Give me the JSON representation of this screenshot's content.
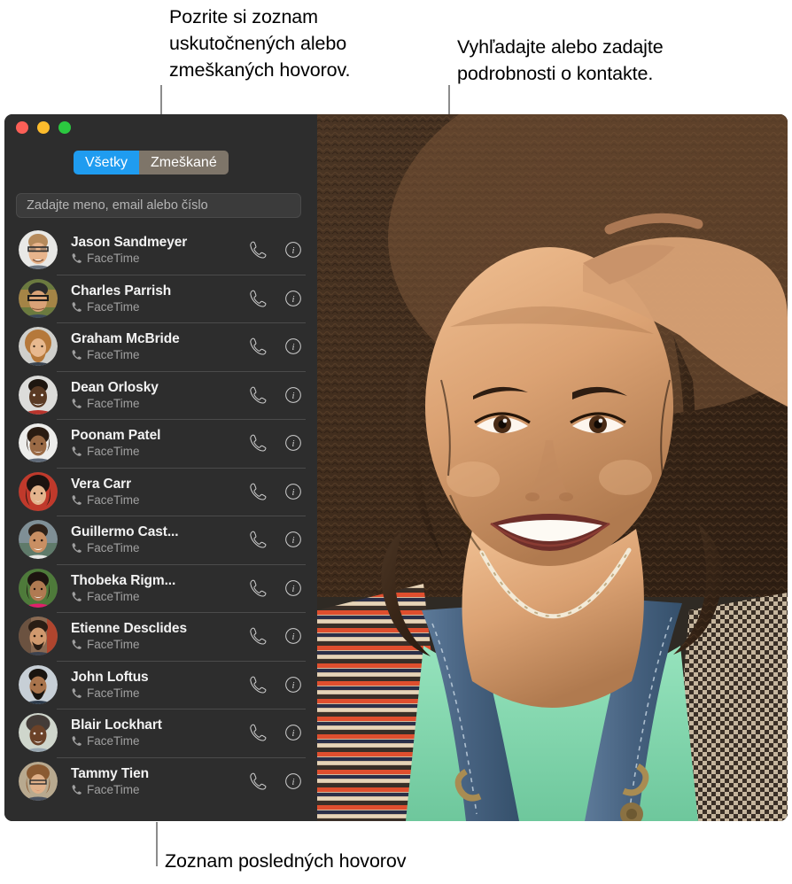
{
  "callouts": {
    "tabs": "Pozrite si zoznam\nuskutočnených alebo\nzmeškaných hovorov.",
    "search": "Vyhľadajte alebo zadajte\npodrobnosti o kontakte.",
    "recents": "Zoznam posledných hovorov"
  },
  "window": {
    "traffic_lights": [
      "close",
      "minimize",
      "zoom"
    ],
    "segmented_control": {
      "options": [
        "Všetky",
        "Zmeškané"
      ],
      "selected": "Všetky",
      "active_color": "#1f9cf0",
      "inactive_color": "#7e7569"
    },
    "search": {
      "placeholder": "Zadajte meno, email alebo číslo",
      "value": ""
    },
    "call_list": [
      {
        "name": "Jason Sandmeyer",
        "service": "FaceTime",
        "avatar": "avatar-jason"
      },
      {
        "name": "Charles Parrish",
        "service": "FaceTime",
        "avatar": "avatar-charles"
      },
      {
        "name": "Graham McBride",
        "service": "FaceTime",
        "avatar": "avatar-graham"
      },
      {
        "name": "Dean Orlosky",
        "service": "FaceTime",
        "avatar": "avatar-dean"
      },
      {
        "name": "Poonam Patel",
        "service": "FaceTime",
        "avatar": "avatar-poonam"
      },
      {
        "name": "Vera Carr",
        "service": "FaceTime",
        "avatar": "avatar-vera"
      },
      {
        "name": "Guillermo Cast...",
        "service": "FaceTime",
        "avatar": "avatar-guillermo"
      },
      {
        "name": "Thobeka Rigm...",
        "service": "FaceTime",
        "avatar": "avatar-thobeka"
      },
      {
        "name": "Etienne Desclides",
        "service": "FaceTime",
        "avatar": "avatar-etienne"
      },
      {
        "name": "John Loftus",
        "service": "FaceTime",
        "avatar": "avatar-john"
      },
      {
        "name": "Blair Lockhart",
        "service": "FaceTime",
        "avatar": "avatar-blair"
      },
      {
        "name": "Tammy Tien",
        "service": "FaceTime",
        "avatar": "avatar-tammy"
      }
    ],
    "row_actions": {
      "call_icon": "phone-handset-icon",
      "info_icon": "info-circle-icon"
    },
    "video_pane": {
      "description": "Portrait of a smiling woman with curly hair, hand raised to her head, wearing a green top, denim overalls and a beaded necklace."
    }
  },
  "colors": {
    "window_background": "#2d2d2d",
    "separator": "#4b4b4b",
    "name_text": "#f2f2f2",
    "sub_text": "#a0a0a0",
    "leader_line": "#8c8c8c",
    "caption_text": "#000000"
  }
}
